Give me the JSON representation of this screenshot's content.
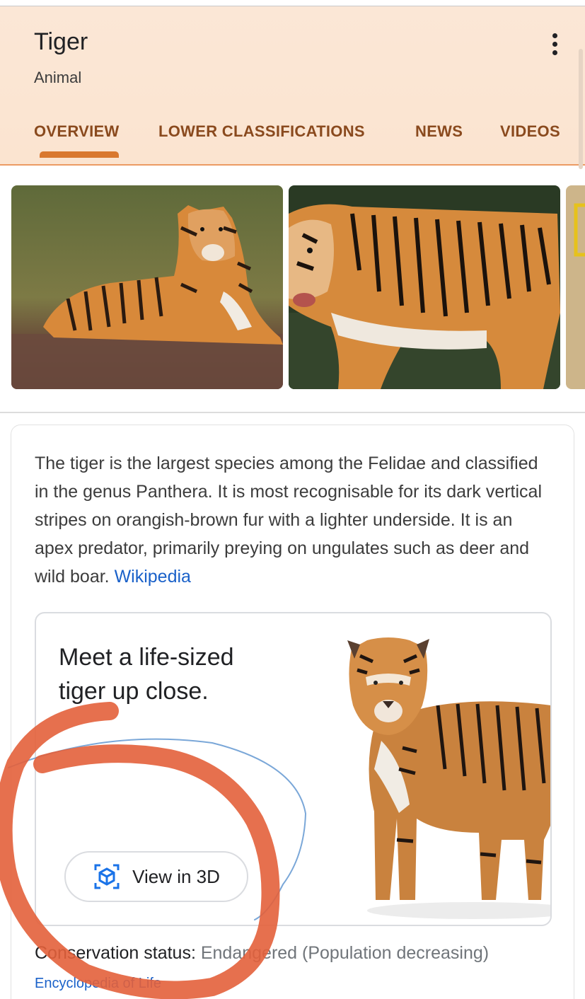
{
  "entity": {
    "title": "Tiger",
    "subtitle": "Animal"
  },
  "tabs": [
    {
      "label": "OVERVIEW",
      "selected": true
    },
    {
      "label": "LOWER CLASSIFICATIONS",
      "selected": false
    },
    {
      "label": "NEWS",
      "selected": false
    },
    {
      "label": "VIDEOS",
      "selected": false
    }
  ],
  "icons": {
    "more": "more-vert-icon",
    "view3d": "cube-3d-icon"
  },
  "colors": {
    "header_bg": "#fbe5d2",
    "tab_text": "#8a4a1e",
    "tab_indicator": "#d9782f",
    "link": "#1a61c9",
    "annotation_red": "#e3603b",
    "annotation_blue": "#7aa7d8"
  },
  "description": {
    "text": "The tiger is the largest species among the Felidae and classified in the genus Panthera. It is most recognisable for its dark vertical stripes on orangish-brown fur with a lighter underside. It is an apex predator, primarily preying on ungulates such as deer and wild boar. ",
    "source_link": "Wikipedia"
  },
  "promo": {
    "line1": "Meet a life-sized",
    "line2": "tiger up close.",
    "button_label": "View in 3D"
  },
  "conservation": {
    "label": "Conservation status: ",
    "value": "Endangered (Population decreasing)",
    "source": "Encyclopedia of Life"
  }
}
